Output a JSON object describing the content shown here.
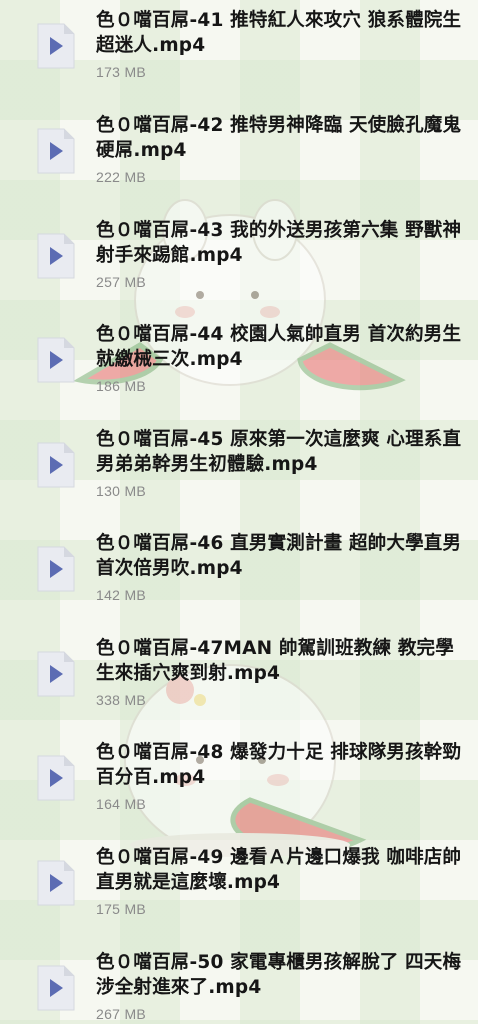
{
  "icons": {
    "file_type": "video-file-icon",
    "file_color": "#e9ebf1",
    "play_color": "#5c6cb3"
  },
  "files": [
    {
      "name": "色０噹百屌-41 推特紅人來攻穴 狼系體院生超迷人.mp4",
      "size": "173 MB"
    },
    {
      "name": "色０噹百屌-42 推特男神降臨 天使臉孔魔鬼硬屌.mp4",
      "size": "222 MB"
    },
    {
      "name": "色０噹百屌-43 我的外送男孩第六集 野獸神射手來踢館.mp4",
      "size": "257 MB"
    },
    {
      "name": "色０噹百屌-44 校園人氣帥直男 首次約男生就繳械三次.mp4",
      "size": "186 MB"
    },
    {
      "name": "色０噹百屌-45 原來第一次這麼爽 心理系直男弟弟幹男生初體驗.mp4",
      "size": "130 MB"
    },
    {
      "name": "色０噹百屌-46 直男實測計畫 超帥大學直男首次倍男吹.mp4",
      "size": "142 MB"
    },
    {
      "name": "色０噹百屌-47MAN 帥駕訓班教練 教完學生來插穴爽到射.mp4",
      "size": "338 MB"
    },
    {
      "name": "色０噹百屌-48 爆發力十足 排球隊男孩幹勁百分百.mp4",
      "size": "164 MB"
    },
    {
      "name": "色０噹百屌-49 邊看Ａ片邊口爆我 咖啡店帥直男就是這麼壞.mp4",
      "size": "175 MB"
    },
    {
      "name": "色０噹百屌-50 家電專櫃男孩解脫了 四天梅涉全射進來了.mp4",
      "size": "267 MB"
    }
  ]
}
